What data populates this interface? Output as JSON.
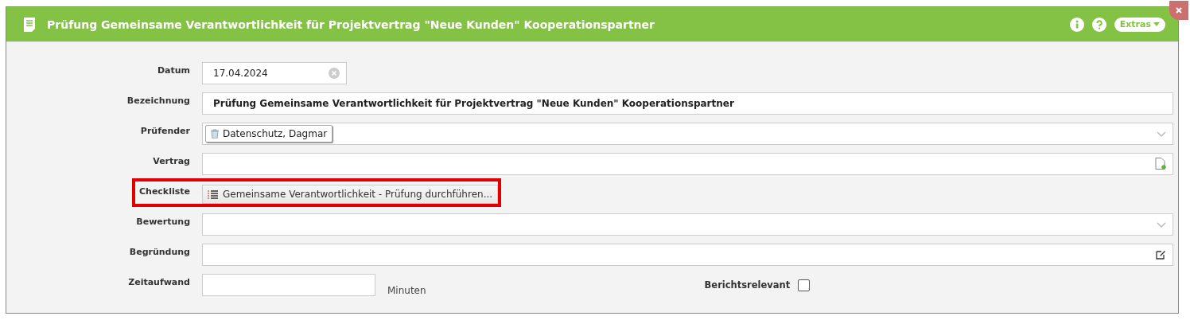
{
  "window": {
    "title": "Prüfung Gemeinsame Verantwortlichkeit für Projektvertrag \"Neue Kunden\" Kooperationspartner",
    "extras_label": "Extras"
  },
  "fields": [
    {
      "kind": "date",
      "label": "Datum",
      "value": "17.04.2024",
      "highlighted": false
    },
    {
      "kind": "text",
      "label": "Bezeichnung",
      "value": "Prüfung Gemeinsame Verantwortlichkeit für Projektvertrag \"Neue Kunden\" Kooperationspartner",
      "highlighted": false
    },
    {
      "kind": "tags",
      "label": "Prüfender",
      "tags": [
        "Datenschutz, Dagmar"
      ],
      "highlighted": false
    },
    {
      "kind": "lookup",
      "label": "Vertrag",
      "highlighted": false
    },
    {
      "kind": "checklist",
      "label": "Checkliste",
      "value": "Gemeinsame Verantwortlichkeit - Prüfung durchführen...",
      "highlighted": true
    },
    {
      "kind": "select",
      "label": "Bewertung",
      "highlighted": false
    },
    {
      "kind": "textarea",
      "label": "Begründung",
      "highlighted": false
    },
    {
      "kind": "duration",
      "label": "Zeitaufwand",
      "unit": "Minuten",
      "highlighted": false,
      "check_label": "Berichtsrelevant",
      "checked": false
    }
  ]
}
